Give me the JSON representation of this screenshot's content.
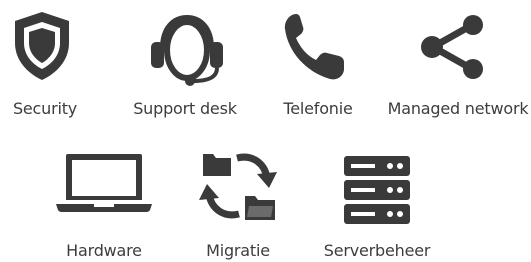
{
  "icon_color": "#3a3a3a",
  "services": [
    {
      "label": "Security",
      "icon": "shield-icon"
    },
    {
      "label": "Support desk",
      "icon": "headset-icon"
    },
    {
      "label": "Telefonie",
      "icon": "phone-icon"
    },
    {
      "label": "Managed network",
      "icon": "share-network-icon"
    },
    {
      "label": "Hardware",
      "icon": "laptop-icon"
    },
    {
      "label": "Migratie",
      "icon": "folder-sync-icon"
    },
    {
      "label": "Serverbeheer",
      "icon": "server-icon"
    }
  ]
}
